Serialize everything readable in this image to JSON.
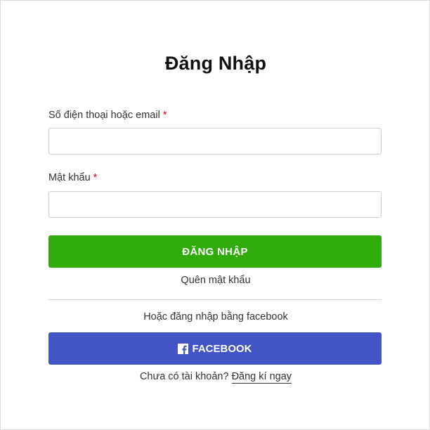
{
  "login": {
    "title": "Đăng Nhập",
    "phone_label": "Số điện thoại hoặc email",
    "password_label": "Mật khẩu",
    "required_mark": "*",
    "phone_value": "",
    "password_value": "",
    "login_button": "ĐĂNG NHẬP",
    "forgot_password": "Quên mật khẩu",
    "or_text": "Hoặc đăng nhập bằng facebook",
    "facebook_button": "FACEBOOK",
    "no_account_text": "Chưa có tài khoản?",
    "signup_link": "Đăng kí ngay"
  },
  "colors": {
    "login_button": "#2fab0b",
    "facebook_button": "#4354c6",
    "required": "#d0021b"
  },
  "icons": {
    "facebook": "facebook-icon"
  }
}
